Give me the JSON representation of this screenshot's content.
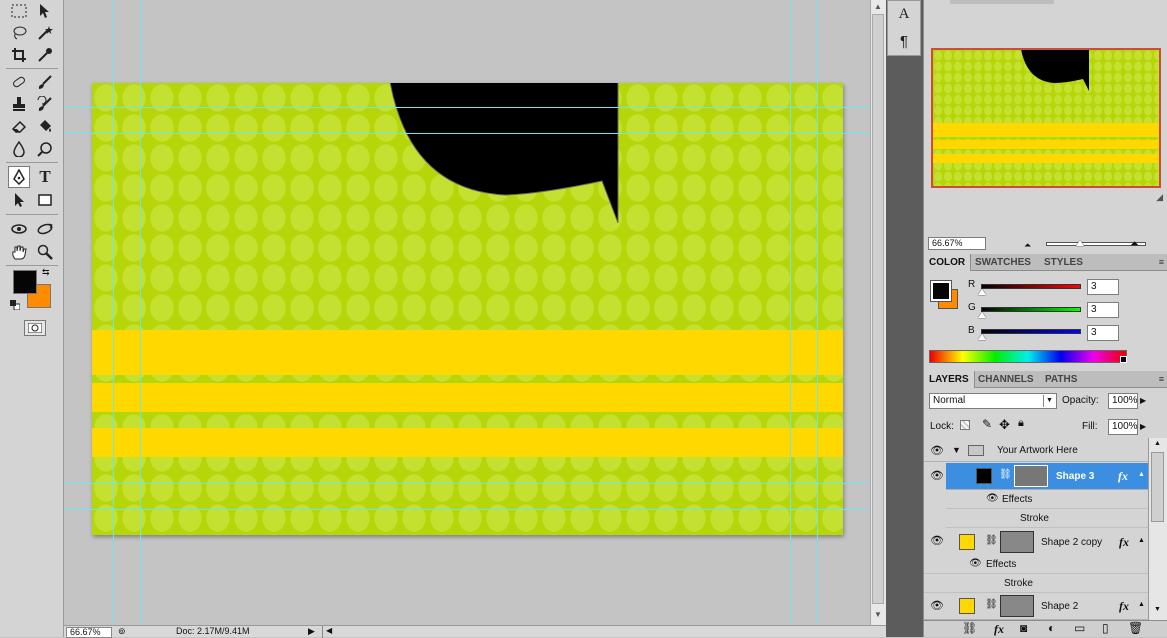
{
  "toolbar": {
    "tools": [
      "marquee-icon",
      "move-icon",
      "lasso-icon",
      "magic-wand-icon",
      "crop-icon",
      "eyedropper-icon",
      "spot-healing-icon",
      "brush-icon",
      "clone-stamp-icon",
      "history-brush-icon",
      "eraser-icon",
      "paint-bucket-icon",
      "blur-icon",
      "dodge-icon",
      "pen-icon",
      "type-icon",
      "path-selection-icon",
      "rectangle-icon",
      "3d-rotate-icon",
      "3d-orbit-icon",
      "hand-icon",
      "zoom-icon"
    ],
    "type_glyph": "T",
    "foreground_color": "#050505",
    "background_color": "#ff8c00"
  },
  "side_panel": {
    "character_glyph": "A",
    "paragraph_glyph": "¶"
  },
  "document": {
    "background": "#b7d60a",
    "stripe_color": "#ffd800",
    "speech_bubble_color": "#000000"
  },
  "status_bar": {
    "zoom": "66.67%",
    "doc_info": "Doc: 2.17M/9.41M"
  },
  "navigator": {
    "zoom": "66.67%"
  },
  "color_panel": {
    "tabs": [
      "COLOR",
      "SWATCHES",
      "STYLES"
    ],
    "r_label": "R",
    "g_label": "G",
    "b_label": "B",
    "r_value": "3",
    "g_value": "3",
    "b_value": "3"
  },
  "layers_panel": {
    "tabs": [
      "LAYERS",
      "CHANNELS",
      "PATHS"
    ],
    "blend_mode": "Normal",
    "opacity_label": "Opacity:",
    "opacity_value": "100%",
    "lock_label": "Lock:",
    "fill_label": "Fill:",
    "fill_value": "100%",
    "group_name": "Your Artwork Here",
    "layers": [
      {
        "name": "Shape 3",
        "color": "#000000",
        "effects_label": "Effects",
        "effect": "Stroke"
      },
      {
        "name": "Shape 2 copy",
        "color": "#ffd800",
        "effects_label": "Effects",
        "effect": "Stroke"
      },
      {
        "name": "Shape 2",
        "color": "#ffd800"
      }
    ],
    "fx_label": "fx"
  }
}
